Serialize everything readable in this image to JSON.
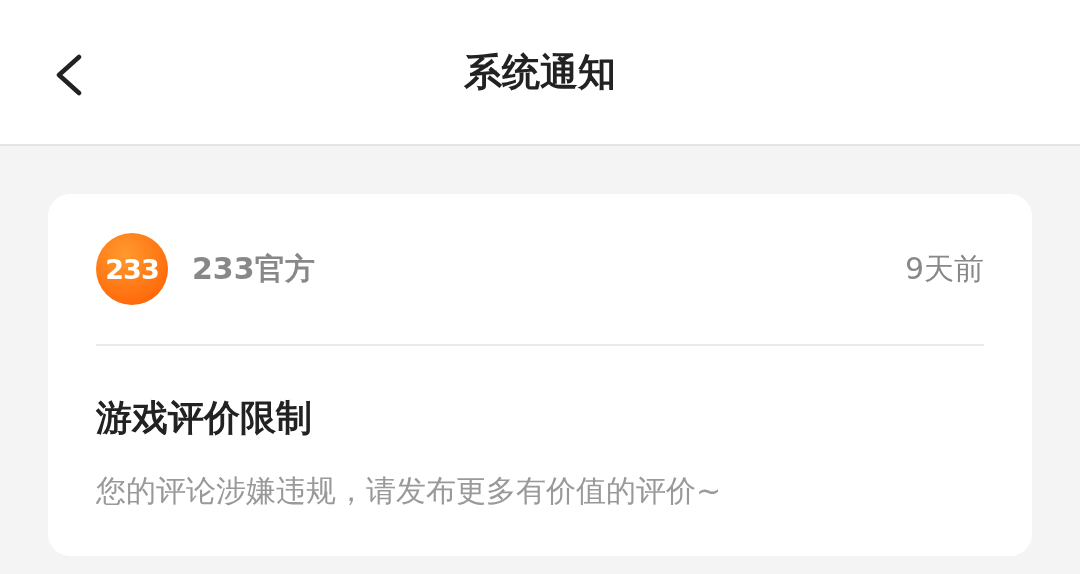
{
  "header": {
    "title": "系统通知"
  },
  "notification": {
    "sender": {
      "logo_text": "233",
      "name": "233官方"
    },
    "time": "9天前",
    "title": "游戏评价限制",
    "message": "您的评论涉嫌违规，请发布更多有价值的评价~"
  }
}
